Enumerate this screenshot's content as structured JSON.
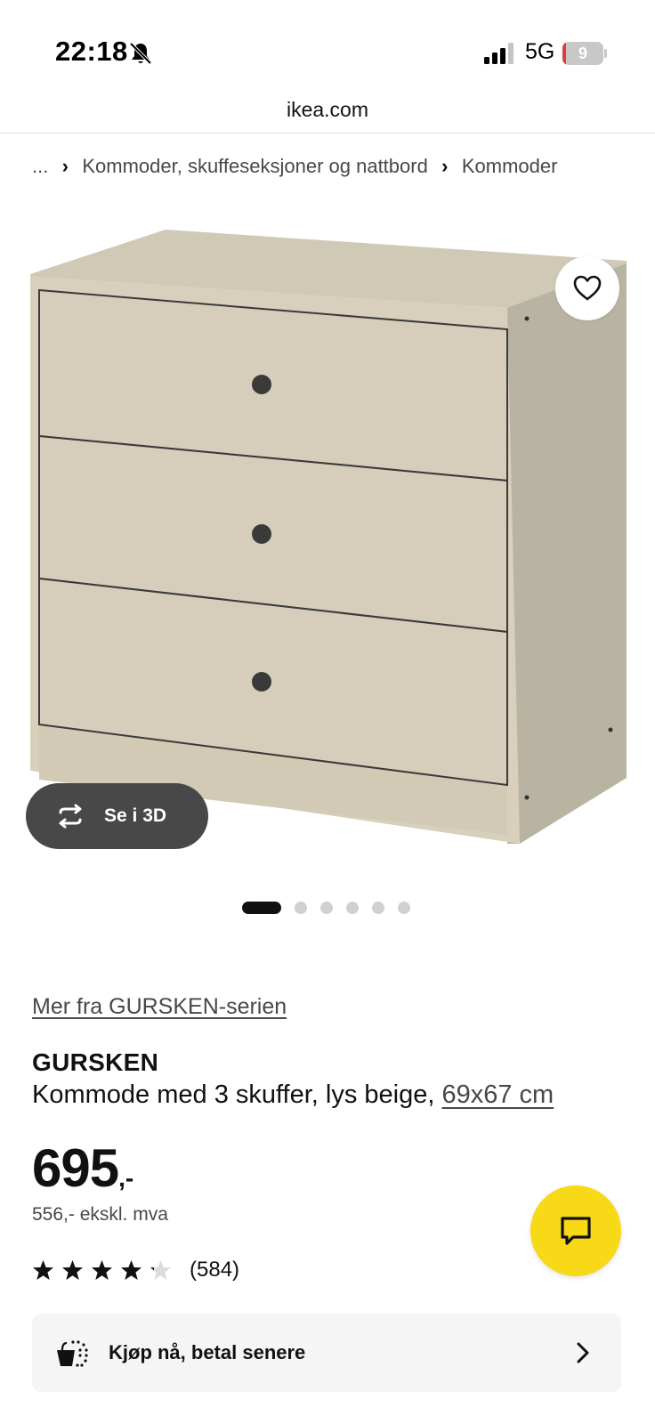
{
  "status_bar": {
    "time": "22:18",
    "network": "5G",
    "battery_level": "9",
    "battery_fraction": 0.09
  },
  "browser": {
    "url": "ikea.com"
  },
  "breadcrumb": {
    "ellipsis": "...",
    "items": [
      "Kommoder, skuffeseksjoner og nattbord",
      "Kommoder"
    ]
  },
  "gallery": {
    "view_3d_label": "Se i 3D",
    "total_images": 6,
    "current_index": 1
  },
  "product": {
    "series_link": "Mer fra GURSKEN-serien",
    "name": "GURSKEN",
    "description": "Kommode med 3 skuffer, lys beige, ",
    "size": "69x67 cm",
    "price_main": "695",
    "price_suffix": ",-",
    "price_ex_vat": "556,- ekskl. mva",
    "rating": 4.2,
    "rating_max": 5,
    "review_count": "(584)"
  },
  "pay_later": {
    "label": "Kjøp nå, betal senere"
  },
  "icons": {
    "favorite": "heart-icon",
    "rotate": "rotate-3d-icon",
    "chat": "chat-bubble-icon",
    "pay_later": "shopping-bag-icon",
    "chevron": "chevron-right-icon",
    "silent": "bell-slash-icon",
    "signal": "signal-icon"
  },
  "colors": {
    "chat_button": "#f7d917",
    "view_3d_button": "#484848",
    "product_beige": "#d8d0bc",
    "battery_low": "#e03a3a"
  }
}
